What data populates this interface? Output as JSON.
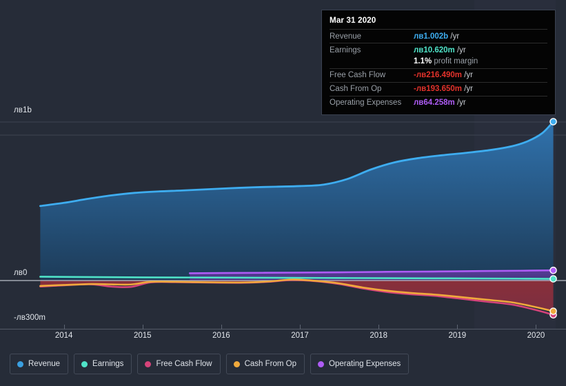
{
  "chart_data": {
    "type": "area",
    "title": "",
    "xlabel": "",
    "ylabel": "",
    "grid": true,
    "legend_position": "bottom-left",
    "xlim": [
      2013.6,
      2020.25
    ],
    "ylim": [
      -300,
      1000
    ],
    "y_unit": "millions лв",
    "x_ticks": [
      2014,
      2015,
      2016,
      2017,
      2018,
      2019,
      2020
    ],
    "y_ticks": [
      {
        "value": 1000,
        "label": "лв1b"
      },
      {
        "value": 0,
        "label": "лв0"
      },
      {
        "value": -300,
        "label": "-лв300m"
      }
    ],
    "series": [
      {
        "name": "Revenue",
        "color": "#3eadf0",
        "x": [
          2013.7,
          2014.0,
          2014.3,
          2014.6,
          2014.9,
          2015.2,
          2015.5,
          2015.8,
          2016.1,
          2016.4,
          2016.7,
          2017.0,
          2017.3,
          2017.6,
          2017.9,
          2018.2,
          2018.5,
          2018.8,
          2019.1,
          2019.4,
          2019.7,
          2019.9,
          2020.08,
          2020.22
        ],
        "values": [
          470,
          490,
          515,
          537,
          553,
          562,
          568,
          575,
          582,
          588,
          592,
          596,
          605,
          640,
          700,
          745,
          772,
          790,
          805,
          822,
          848,
          880,
          930,
          1002
        ]
      },
      {
        "name": "Earnings",
        "color": "#4fe3c8",
        "x": [
          2013.7,
          2014.3,
          2015.0,
          2015.6,
          2016.2,
          2016.9,
          2017.5,
          2018.1,
          2018.7,
          2019.3,
          2019.8,
          2020.22
        ],
        "values": [
          24,
          22,
          20,
          19,
          18,
          17,
          16,
          15,
          14,
          13,
          12,
          10.62
        ]
      },
      {
        "name": "Free Cash Flow",
        "color": "#d6437a",
        "x": [
          2013.7,
          2014.0,
          2014.35,
          2014.6,
          2014.85,
          2015.1,
          2015.4,
          2015.7,
          2016.0,
          2016.3,
          2016.6,
          2016.9,
          2017.2,
          2017.5,
          2017.8,
          2018.1,
          2018.4,
          2018.7,
          2019.0,
          2019.35,
          2019.7,
          2020.0,
          2020.22
        ],
        "values": [
          -38,
          -30,
          -24,
          -38,
          -40,
          -12,
          -10,
          -12,
          -14,
          -14,
          -8,
          3,
          -4,
          -22,
          -50,
          -72,
          -86,
          -96,
          -112,
          -132,
          -152,
          -186,
          -216.49
        ]
      },
      {
        "name": "Cash From Op",
        "color": "#f0a93c",
        "x": [
          2013.7,
          2014.0,
          2014.35,
          2014.6,
          2014.85,
          2015.1,
          2015.4,
          2015.7,
          2016.0,
          2016.3,
          2016.6,
          2016.9,
          2017.2,
          2017.5,
          2017.8,
          2018.1,
          2018.4,
          2018.7,
          2019.0,
          2019.35,
          2019.7,
          2020.0,
          2020.22
        ],
        "values": [
          -34,
          -28,
          -22,
          -24,
          -25,
          -8,
          -8,
          -10,
          -12,
          -12,
          -6,
          6,
          -2,
          -18,
          -44,
          -64,
          -78,
          -88,
          -102,
          -120,
          -138,
          -168,
          -193.65
        ]
      },
      {
        "name": "Operating Expenses",
        "color": "#ae5cf5",
        "x": [
          2015.6,
          2016.2,
          2016.9,
          2017.5,
          2018.1,
          2018.7,
          2019.3,
          2019.8,
          2020.22
        ],
        "values": [
          46,
          48,
          50,
          52,
          55,
          57,
          60,
          62,
          64.258
        ]
      }
    ]
  },
  "y_axis": {
    "top_label": "лв1b",
    "zero_label": "лв0",
    "bottom_label": "-лв300m"
  },
  "x_axis": {
    "ticks": [
      "2014",
      "2015",
      "2016",
      "2017",
      "2018",
      "2019",
      "2020"
    ]
  },
  "tooltip": {
    "date": "Mar 31 2020",
    "rows": [
      {
        "key": "Revenue",
        "prefix": "лв",
        "amount": "1.002b",
        "suffix": " /yr",
        "color_class": "c-rev",
        "negative": false
      },
      {
        "key": "Earnings",
        "prefix": "лв",
        "amount": "10.620m",
        "suffix": " /yr",
        "color_class": "c-earn",
        "negative": false
      },
      {
        "key": "Free Cash Flow",
        "prefix": "-лв",
        "amount": "216.490m",
        "suffix": " /yr",
        "color_class": "c-neg",
        "negative": true
      },
      {
        "key": "Cash From Op",
        "prefix": "-лв",
        "amount": "193.650m",
        "suffix": " /yr",
        "color_class": "c-neg",
        "negative": true
      },
      {
        "key": "Operating Expenses",
        "prefix": "лв",
        "amount": "64.258m",
        "suffix": " /yr",
        "color_class": "c-opex",
        "negative": false
      }
    ],
    "profit_margin_value": "1.1%",
    "profit_margin_label": " profit margin"
  },
  "legend": {
    "items": [
      {
        "label": "Revenue",
        "color": "#3a9fe0"
      },
      {
        "label": "Earnings",
        "color": "#4fe3c8"
      },
      {
        "label": "Free Cash Flow",
        "color": "#d6437a"
      },
      {
        "label": "Cash From Op",
        "color": "#f0a93c"
      },
      {
        "label": "Operating Expenses",
        "color": "#ae5cf5"
      }
    ]
  },
  "colors": {
    "background": "#262c38",
    "gridline": "#3d4452",
    "zero_line": "#b9bfc8",
    "tooltip_bg": "#040404"
  }
}
